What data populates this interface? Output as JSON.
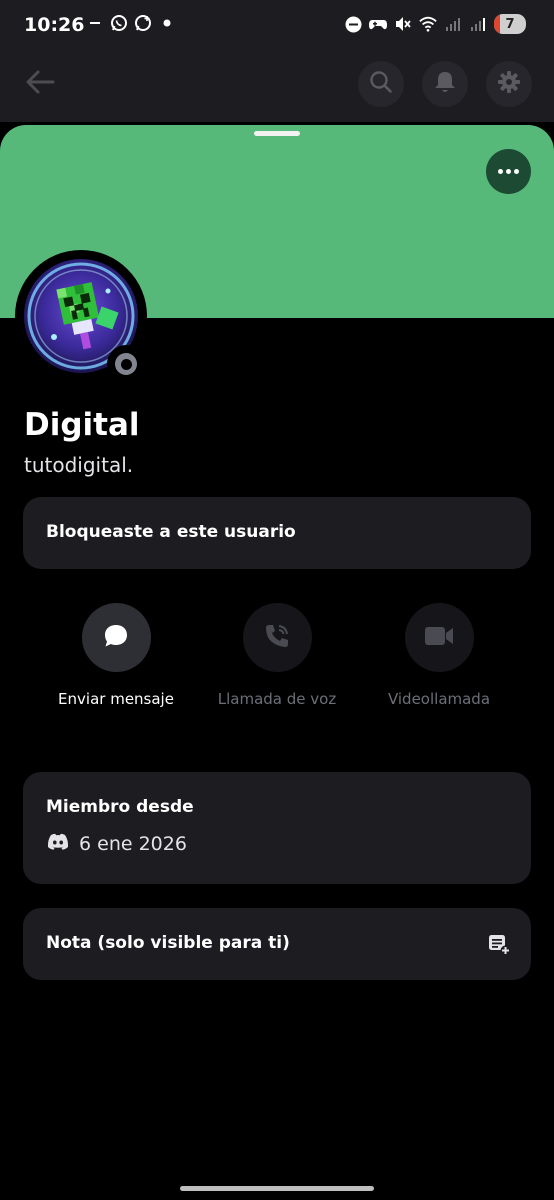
{
  "status_bar": {
    "time": "10:26",
    "left_icons": [
      "minus-icon",
      "whatsapp-icon",
      "whatsapp-business-icon",
      "dot-icon"
    ],
    "right_icons": [
      "do-not-disturb-icon",
      "gamepad-icon",
      "mute-icon",
      "wifi-icon",
      "signal-icon",
      "signal-icon"
    ],
    "battery_level": "7"
  },
  "header": {
    "back_icon": "arrow-left-icon",
    "actions": [
      "search-icon",
      "bell-icon",
      "gear-icon"
    ]
  },
  "profile": {
    "banner_color": "#56b97a",
    "display_name": "Digital",
    "username": "tutodigital.",
    "presence": "offline"
  },
  "blocked_notice": "Bloqueaste a este usuario",
  "actions": [
    {
      "label": "Enviar mensaje",
      "icon": "chat-bubble-icon",
      "enabled": true
    },
    {
      "label": "Llamada de voz",
      "icon": "phone-call-icon",
      "enabled": false
    },
    {
      "label": "Videollamada",
      "icon": "video-camera-icon",
      "enabled": false
    }
  ],
  "member_since": {
    "title": "Miembro desde",
    "icon": "discord-icon",
    "date": "6 ene 2026"
  },
  "note": {
    "label": "Nota (solo visible para ti)",
    "icon": "add-note-icon"
  },
  "colors": {
    "background": "#000000",
    "card": "#1c1c21",
    "accent_banner": "#56b97a",
    "disabled_text": "#6d6f78"
  }
}
